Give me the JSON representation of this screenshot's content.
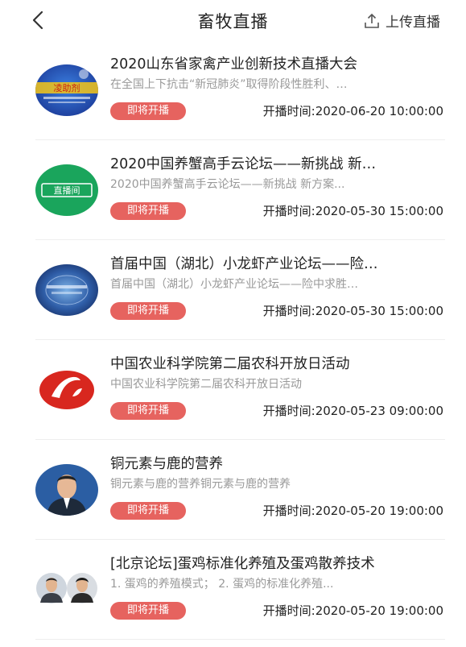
{
  "header": {
    "back_icon": "chevron-left-icon",
    "title": "畜牧直播",
    "upload_icon": "upload-icon",
    "upload_label": "上传直播"
  },
  "colors": {
    "badge": "#e6635f",
    "title_text": "#222222",
    "subtitle_text": "#999999"
  },
  "items": [
    {
      "title": "2020山东省家禽产业创新技术直播大会",
      "subtitle": "在全国上下抗击“新冠肺炎”取得阶段性胜利、…",
      "badge": "即将开播",
      "time_label": "开播时间:",
      "time": "2020-06-20 10:00:00"
    },
    {
      "title": "2020中国养蟹高手云论坛——新挑战 新…",
      "subtitle": "2020中国养蟹高手云论坛——新挑战 新方案...",
      "badge": "即将开播",
      "time_label": "开播时间:",
      "time": "2020-05-30 15:00:00"
    },
    {
      "title": "首届中国（湖北）小龙虾产业论坛——险…",
      "subtitle": "首届中国（湖北）小龙虾产业论坛——险中求胜…",
      "badge": "即将开播",
      "time_label": "开播时间:",
      "time": "2020-05-30 15:00:00"
    },
    {
      "title": "中国农业科学院第二届农科开放日活动",
      "subtitle": "中国农业科学院第二届农科开放日活动",
      "badge": "即将开播",
      "time_label": "开播时间:",
      "time": "2020-05-23 09:00:00"
    },
    {
      "title": "铜元素与鹿的营养",
      "subtitle": "铜元素与鹿的营养铜元素与鹿的营养",
      "badge": "即将开播",
      "time_label": "开播时间:",
      "time": "2020-05-20 19:00:00"
    },
    {
      "title": "[北京论坛]蛋鸡标准化养殖及蛋鸡散养技术",
      "subtitle": "1. 蛋鸡的养殖模式； 2. 蛋鸡的标准化养殖...",
      "badge": "即将开播",
      "time_label": "开播时间:",
      "time": "2020-05-20 19:00:00"
    }
  ],
  "thumb_texts": {
    "item1": "凌助剂",
    "item2": "直播间"
  }
}
